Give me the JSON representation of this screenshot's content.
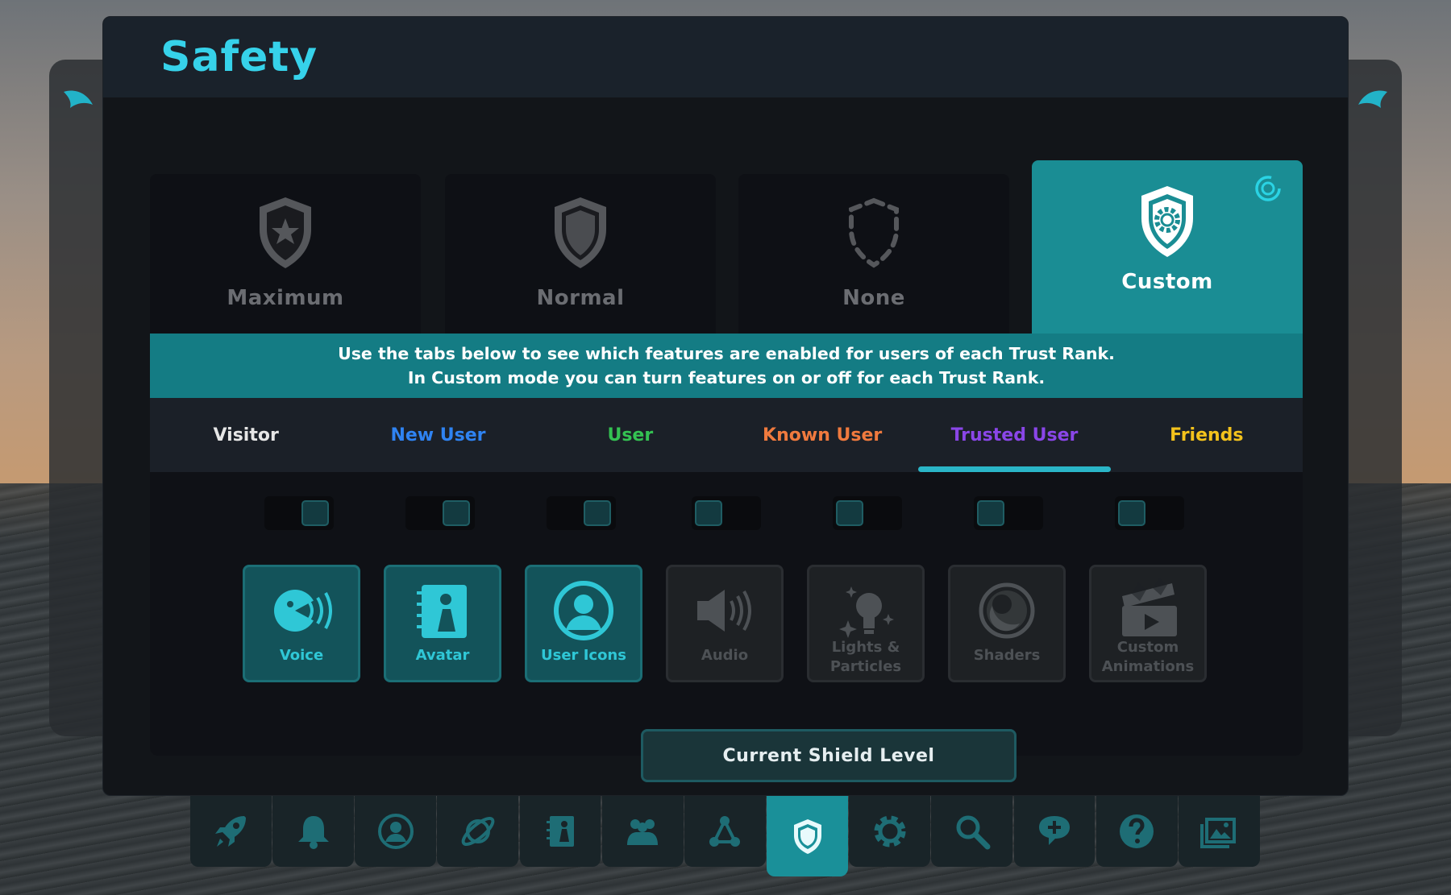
{
  "window": {
    "title": "Safety"
  },
  "shield_levels": [
    {
      "label": "Maximum",
      "icon": "shield-star-icon",
      "active": false
    },
    {
      "label": "Normal",
      "icon": "shield-icon",
      "active": false
    },
    {
      "label": "None",
      "icon": "shield-dashed-icon",
      "active": false
    },
    {
      "label": "Custom",
      "icon": "shield-gear-icon",
      "active": true
    }
  ],
  "info_text": {
    "line1": "Use the tabs below to see which features are enabled for users of each Trust Rank.",
    "line2": "In Custom mode you can turn features on or off for each Trust Rank."
  },
  "trust_tabs": [
    {
      "label": "Visitor",
      "color": "#e6e6e6",
      "active": false
    },
    {
      "label": "New User",
      "color": "#2f83f2",
      "active": false
    },
    {
      "label": "User",
      "color": "#34c252",
      "active": false
    },
    {
      "label": "Known User",
      "color": "#f07a3e",
      "active": false
    },
    {
      "label": "Trusted User",
      "color": "#8a46e8",
      "active": true
    },
    {
      "label": "Friends",
      "color": "#f3c21c",
      "active": false
    }
  ],
  "features": [
    {
      "label_line1": "Voice",
      "label_line2": "",
      "enabled": true,
      "icon": "voice-icon"
    },
    {
      "label_line1": "Avatar",
      "label_line2": "",
      "enabled": true,
      "icon": "avatar-icon"
    },
    {
      "label_line1": "User Icons",
      "label_line2": "",
      "enabled": true,
      "icon": "user-icons-icon"
    },
    {
      "label_line1": "Audio",
      "label_line2": "",
      "enabled": false,
      "icon": "audio-icon"
    },
    {
      "label_line1": "Lights &",
      "label_line2": "Particles",
      "enabled": false,
      "icon": "lights-particles-icon"
    },
    {
      "label_line1": "Shaders",
      "label_line2": "",
      "enabled": false,
      "icon": "shaders-icon"
    },
    {
      "label_line1": "Custom",
      "label_line2": "Animations",
      "enabled": false,
      "icon": "custom-animations-icon"
    }
  ],
  "current_shield_button": "Current Shield Level",
  "dock": [
    {
      "icon": "rocket-icon",
      "active": false
    },
    {
      "icon": "bell-icon",
      "active": false
    },
    {
      "icon": "profile-icon",
      "active": false
    },
    {
      "icon": "planet-icon",
      "active": false
    },
    {
      "icon": "avatar-book-icon",
      "active": false
    },
    {
      "icon": "social-icon",
      "active": false
    },
    {
      "icon": "network-icon",
      "active": false
    },
    {
      "icon": "safety-shield-icon",
      "active": true
    },
    {
      "icon": "gear-icon",
      "active": false
    },
    {
      "icon": "search-icon",
      "active": false
    },
    {
      "icon": "add-chat-icon",
      "active": false
    },
    {
      "icon": "help-icon",
      "active": false
    },
    {
      "icon": "gallery-icon",
      "active": false
    }
  ],
  "colors": {
    "accent": "#1a8d94",
    "title": "#36d2ea",
    "feature_on": "#2fc7d6",
    "feature_off": "#4d5155"
  }
}
